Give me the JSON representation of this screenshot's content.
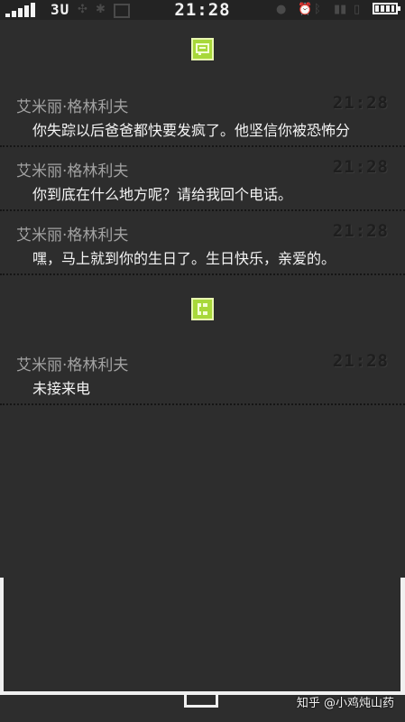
{
  "statusbar": {
    "carrier": "3U",
    "clock": "21:28",
    "signal_bars": 5,
    "battery_level": 1.0
  },
  "groups": [
    {
      "type": "message",
      "icon": "chat-bubble-icon",
      "messages": [
        {
          "sender": "艾米丽·格林利夫",
          "time": "21:28",
          "text": "你失踪以后爸爸都快要发疯了。他坚信你被恐怖分"
        },
        {
          "sender": "艾米丽·格林利夫",
          "time": "21:28",
          "text": "你到底在什么地方呢？请给我回个电话。"
        },
        {
          "sender": "艾米丽·格林利夫",
          "time": "21:28",
          "text": "嘿，马上就到你的生日了。生日快乐，亲爱的。"
        }
      ]
    },
    {
      "type": "call",
      "icon": "phone-icon",
      "messages": [
        {
          "sender": "艾米丽·格林利夫",
          "time": "21:28",
          "text": "未接来电"
        }
      ]
    }
  ],
  "watermark": "知乎 @小鸡炖山药",
  "colors": {
    "background": "#2d2d2d",
    "accent": "#a8d83a",
    "sender": "#a2a2a2",
    "body": "#f4f4f4",
    "frame": "#f0f0f0"
  }
}
